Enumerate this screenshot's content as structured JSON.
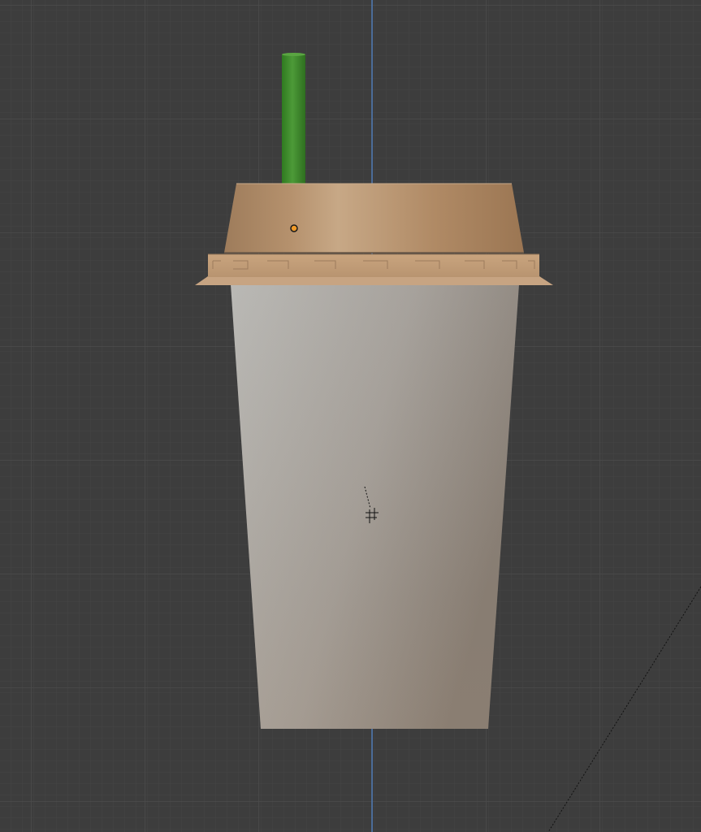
{
  "viewport": {
    "label": "",
    "background_color": "#3d3d3d",
    "grid_minor_color": "#444444",
    "grid_major_color": "#4a4a4a",
    "axis_z_color": "#4f7bb5",
    "camera_frame_line": "dotted"
  },
  "scene": {
    "cup": {
      "body_colors": [
        "#b4b2ae",
        "#a39e98",
        "#887f77"
      ],
      "sleeve_colors": [
        "#c59d76",
        "#a27c5a"
      ],
      "lid_colors": [
        "#9d7a58",
        "#c8a886",
        "#a07853"
      ],
      "straw_color": "#3f8a2c"
    },
    "origin_marker": {
      "icon": "object-origin-icon",
      "color": "#f09a28"
    },
    "cursor_3d": {
      "icon": "3d-cursor-icon"
    }
  }
}
